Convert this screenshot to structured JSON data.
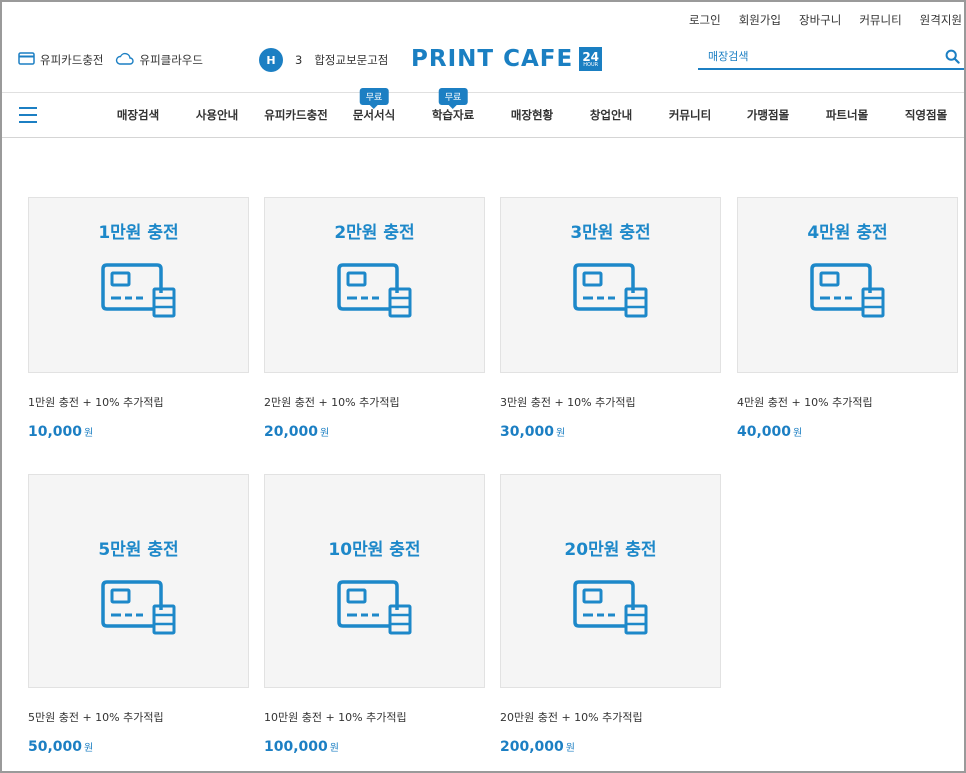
{
  "top_links": [
    "로그인",
    "회원가입",
    "장바구니",
    "커뮤니티",
    "원격지원"
  ],
  "header": {
    "card_charge": "유피카드충전",
    "cloud": "유피클라우드",
    "store_badge": "H",
    "store_number": "3",
    "store_name": "합정교보문고점",
    "logo_text": "PRINT CAFE",
    "logo_24": "24",
    "logo_hour": "HOUR",
    "search_placeholder": "매장검색"
  },
  "nav": {
    "items": [
      "매장검색",
      "사용안내",
      "유피카드충전",
      "문서서식",
      "학습자료",
      "매장현황",
      "창업안내",
      "커뮤니티",
      "가맹점몰",
      "파트너몰",
      "직영점몰"
    ],
    "free_badge": "무료"
  },
  "products": [
    {
      "title": "1만원 충전",
      "name": "1만원 충전 + 10% 추가적립",
      "price": "10,000",
      "unit": "원"
    },
    {
      "title": "2만원 충전",
      "name": "2만원 충전 + 10% 추가적립",
      "price": "20,000",
      "unit": "원"
    },
    {
      "title": "3만원 충전",
      "name": "3만원 충전 + 10% 추가적립",
      "price": "30,000",
      "unit": "원"
    },
    {
      "title": "4만원 충전",
      "name": "4만원 충전 + 10% 추가적립",
      "price": "40,000",
      "unit": "원"
    },
    {
      "title": "5만원 충전",
      "name": "5만원 충전 + 10% 추가적립",
      "price": "50,000",
      "unit": "원"
    },
    {
      "title": "10만원 충전",
      "name": "10만원 충전 + 10% 추가적립",
      "price": "100,000",
      "unit": "원"
    },
    {
      "title": "20만원 충전",
      "name": "20만원 충전 + 10% 추가적립",
      "price": "200,000",
      "unit": "원"
    }
  ],
  "colors": {
    "brand": "#1c7fc3",
    "thumb_bg": "#f5f5f5",
    "icon_blue": "#1d88c9"
  }
}
